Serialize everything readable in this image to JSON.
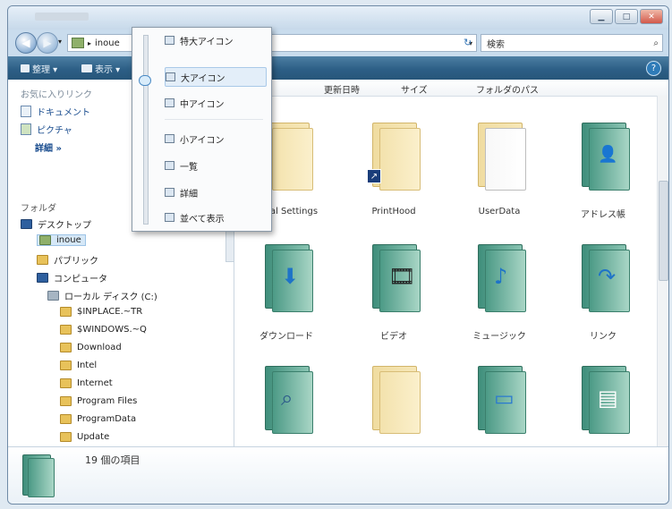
{
  "toolbar": {
    "organize": "整理 ▾",
    "views": "表示 ▾"
  },
  "address": {
    "path": "inoue",
    "search_placeholder": "検索"
  },
  "navpane": {
    "favorites_title": "お気に入りリンク",
    "favorites": [
      {
        "label": "ドキュメント",
        "icon": "document-icon"
      },
      {
        "label": "ピクチャ",
        "icon": "picture-icon"
      },
      {
        "label": "詳細 »",
        "icon": ""
      }
    ],
    "folders_title": "フォルダ",
    "tree": [
      {
        "label": "デスクトップ",
        "icon": "desktop-icon"
      },
      {
        "label": "inoue",
        "icon": "user-folder-icon",
        "selected": true
      },
      {
        "label": "パブリック",
        "icon": "folder-icon"
      },
      {
        "label": "コンピュータ",
        "icon": "computer-icon"
      },
      {
        "label": "ローカル ディスク (C:)",
        "icon": "drive-icon"
      },
      {
        "label": "$INPLACE.~TR",
        "icon": "folder-icon"
      },
      {
        "label": "$WINDOWS.~Q",
        "icon": "folder-icon"
      },
      {
        "label": "Download",
        "icon": "folder-icon"
      },
      {
        "label": "Intel",
        "icon": "folder-icon"
      },
      {
        "label": "Internet",
        "icon": "folder-icon"
      },
      {
        "label": "Program Files",
        "icon": "folder-icon"
      },
      {
        "label": "ProgramData",
        "icon": "folder-icon"
      },
      {
        "label": "Update",
        "icon": "folder-icon"
      }
    ]
  },
  "columns": [
    "更新日時",
    "サイズ",
    "フォルダのパス"
  ],
  "items": [
    {
      "label": "Local Settings",
      "icon": "folder-icon"
    },
    {
      "label": "PrintHood",
      "icon": "shortcut-folder-icon"
    },
    {
      "label": "UserData",
      "icon": "document-folder-icon"
    },
    {
      "label": "アドレス帳",
      "icon": "contacts-folder-icon"
    },
    {
      "label": "ダウンロード",
      "icon": "downloads-folder-icon"
    },
    {
      "label": "ビデオ",
      "icon": "videos-folder-icon"
    },
    {
      "label": "ミュージック",
      "icon": "music-folder-icon"
    },
    {
      "label": "リンク",
      "icon": "links-folder-icon"
    },
    {
      "label": "",
      "icon": "search-folder-icon"
    },
    {
      "label": "",
      "icon": "folder-icon"
    },
    {
      "label": "",
      "icon": "desktop-folder-icon"
    },
    {
      "label": "",
      "icon": "documents-folder-icon"
    }
  ],
  "view_menu": [
    {
      "label": "特大アイコン",
      "icon": "extra-large-icons-icon"
    },
    {
      "label": "大アイコン",
      "icon": "large-icons-icon",
      "selected": true
    },
    {
      "label": "中アイコン",
      "icon": "medium-icons-icon"
    },
    {
      "label": "小アイコン",
      "icon": "small-icons-icon"
    },
    {
      "label": "一覧",
      "icon": "list-view-icon"
    },
    {
      "label": "詳細",
      "icon": "details-view-icon"
    },
    {
      "label": "並べて表示",
      "icon": "tiles-view-icon"
    }
  ],
  "details_pane": {
    "count_text": "19 個の項目"
  }
}
